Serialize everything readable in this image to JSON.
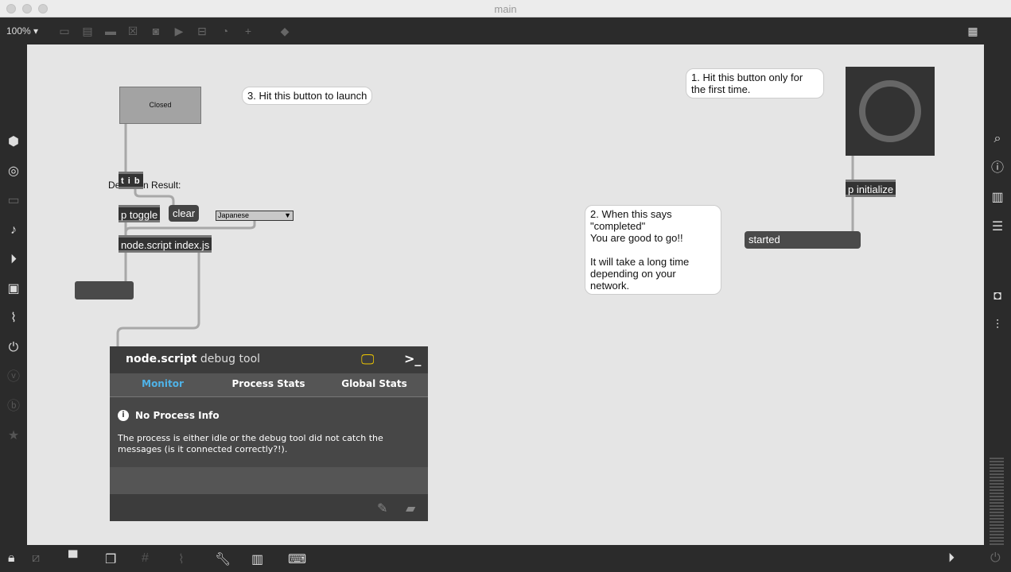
{
  "window": {
    "title": "main"
  },
  "toolbar": {
    "zoom": "100%"
  },
  "patch": {
    "toggle_button": "Closed",
    "comment3": "3. Hit this button to launch",
    "comment1": "1. Hit this button only for the first time.",
    "comment2_lines": [
      "2. When this says",
      "\"completed\"",
      "You are good to go!!",
      "",
      "It will take a long time",
      "depending on your network."
    ],
    "tib": "t i b",
    "detection_label": "Detection Result:",
    "ptoggle": "p toggle",
    "clear": "clear",
    "language": "Japanese",
    "nodescript": "node.script index.js",
    "pinit": "p initialize",
    "status": "started"
  },
  "debug": {
    "title_bold": "node.script",
    "title_rest": "debug tool",
    "tabs": [
      "Monitor",
      "Process Stats",
      "Global Stats"
    ],
    "active_color": "#4fb3e8",
    "info_title": "No Process Info",
    "info_text": "The process is either idle or the debug tool did not catch the messages (is it connected correctly?!)."
  }
}
